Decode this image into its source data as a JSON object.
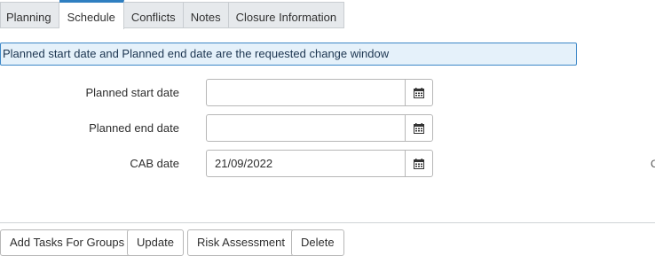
{
  "tabs": [
    {
      "label": "Planning"
    },
    {
      "label": "Schedule",
      "active": true
    },
    {
      "label": "Conflicts"
    },
    {
      "label": "Notes"
    },
    {
      "label": "Closure Information"
    }
  ],
  "info_message": "Planned start date and Planned end date are the requested change window",
  "fields": {
    "planned_start": {
      "label": "Planned start date",
      "value": ""
    },
    "planned_end": {
      "label": "Planned end date",
      "value": ""
    },
    "cab_date": {
      "label": "CAB date",
      "value": "21/09/2022"
    }
  },
  "edge_text": "C",
  "buttons": {
    "add_tasks": "Add Tasks For Groups",
    "update": "Update",
    "risk": "Risk Assessment",
    "delete": "Delete"
  },
  "icons": {
    "calendar": "calendar-icon"
  },
  "colors": {
    "accent": "#2f7fc1",
    "info_bg": "#e5f1fa",
    "info_border": "#3c87c7"
  }
}
